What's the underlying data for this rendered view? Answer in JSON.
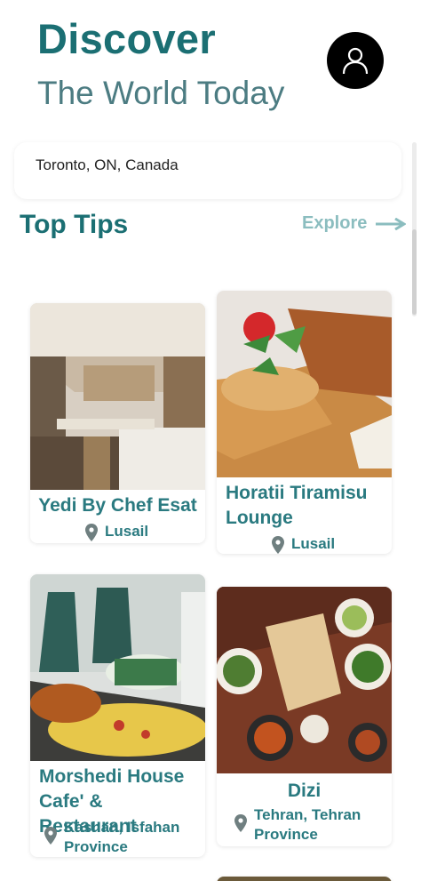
{
  "header": {
    "title": "Discover",
    "subtitle": "The World Today",
    "avatar_icon": "user-icon"
  },
  "location": {
    "value": "Toronto, ON, Canada"
  },
  "section": {
    "title": "Top Tips",
    "explore_label": "Explore",
    "explore_icon": "arrow-right-icon"
  },
  "places": [
    {
      "name": "Yedi By Chef Esat",
      "location": "Lusail",
      "pin_icon": "location-pin-icon"
    },
    {
      "name": "Horatii Tiramisu Lounge",
      "location": "Lusail",
      "pin_icon": "location-pin-icon"
    },
    {
      "name": "Morshedi House Cafe' & Restaurant",
      "location": "Kashan, Isfahan Province",
      "pin_icon": "location-pin-icon"
    },
    {
      "name": "Dizi",
      "location": "Tehran, Tehran Province",
      "pin_icon": "location-pin-icon"
    }
  ],
  "colors": {
    "accent": "#1b6f73",
    "subtitle": "#4c7c82",
    "card_text": "#2a7a80",
    "explore": "#8bbdbf"
  }
}
